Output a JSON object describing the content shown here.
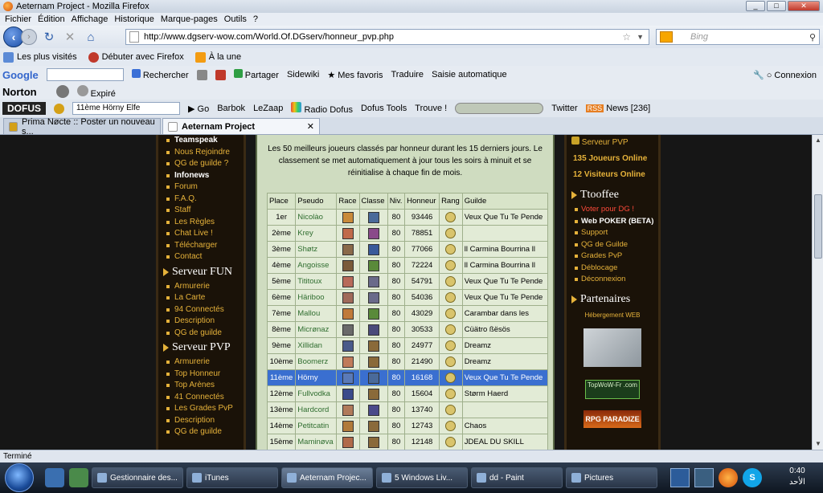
{
  "window": {
    "title": "Aeternam Project - Mozilla Firefox"
  },
  "menu": [
    "Fichier",
    "Édition",
    "Affichage",
    "Historique",
    "Marque-pages",
    "Outils",
    "?"
  ],
  "nav": {
    "url": "http://www.dgserv-wow.com/World.Of.DGserv/honneur_pvp.php",
    "search_placeholder": "Bing"
  },
  "bookmarks": [
    "Les plus visités",
    "Débuter avec Firefox",
    "À la une"
  ],
  "toolbar1": {
    "google": "Google",
    "rechercher": "Rechercher",
    "partager": "Partager",
    "sidewiki": "Sidewiki",
    "favoris": "Mes favoris",
    "traduire": "Traduire",
    "saisie": "Saisie automatique",
    "connexion": "Connexion"
  },
  "toolbar2": {
    "norton": "Norton",
    "expire": "Expiré"
  },
  "toolbar3": {
    "dofus": "DOFUS",
    "search_text": "11ème   Hörny   Elfe",
    "go": "Go",
    "barbok": "Barbok",
    "lezaap": "LeZaap",
    "radio": "Radio Dofus",
    "tools": "Dofus Tools",
    "trouve": "Trouve !",
    "twitter": "Twitter",
    "news": "News [236]"
  },
  "tabs": [
    {
      "label": "Prima Nøcte :: Poster un nouveau s...",
      "active": false
    },
    {
      "label": "Aeternam Project",
      "active": true
    }
  ],
  "left_menu": {
    "top_links": [
      {
        "label": "Teamspeak",
        "white": true
      },
      {
        "label": "Nous Rejoindre",
        "white": false
      },
      {
        "label": "QG de guilde ?",
        "white": false
      },
      {
        "label": "Infonews",
        "white": true
      },
      {
        "label": "Forum",
        "white": false
      },
      {
        "label": "F.A.Q.",
        "white": false
      },
      {
        "label": "Staff",
        "white": false
      },
      {
        "label": "Les Règles",
        "white": false
      },
      {
        "label": "Chat Live !",
        "white": false
      },
      {
        "label": "Télécharger",
        "white": false
      },
      {
        "label": "Contact",
        "white": false
      }
    ],
    "fun_title": "Serveur FUN",
    "fun_links": [
      "Armurerie",
      "La Carte",
      "94 Connectés",
      "Description",
      "QG de guilde"
    ],
    "pvp_title": "Serveur PVP",
    "pvp_links": [
      "Armurerie",
      "Top Honneur",
      "Top Arènes",
      "41 Connectés",
      "Les Grades PvP",
      "Description",
      "QG de guilde"
    ]
  },
  "intro": "Les 50 meilleurs joueurs classés par honneur durant les 15 derniers jours. Le classement se met automatiquement à jour tous les soirs à minuit et se réinitialise à chaque fin de mois.",
  "table": {
    "headers": [
      "Place",
      "Pseudo",
      "Race",
      "Classe",
      "Niv.",
      "Honneur",
      "Rang",
      "Guilde"
    ],
    "rows": [
      {
        "place": "1er",
        "pseudo": "Nicolào",
        "niv": "80",
        "honneur": "93446",
        "guilde": "Veux Que Tu Te Pende"
      },
      {
        "place": "2ème",
        "pseudo": "Krey",
        "niv": "80",
        "honneur": "78851",
        "guilde": ""
      },
      {
        "place": "3ème",
        "pseudo": "Shøtz",
        "niv": "80",
        "honneur": "77066",
        "guilde": "ll Carmina Bourrina ll"
      },
      {
        "place": "4ème",
        "pseudo": "Angoisse",
        "niv": "80",
        "honneur": "72224",
        "guilde": "ll Carmina Bourrina ll"
      },
      {
        "place": "5ème",
        "pseudo": "Tititoux",
        "niv": "80",
        "honneur": "54791",
        "guilde": "Veux Que Tu Te Pende"
      },
      {
        "place": "6ème",
        "pseudo": "Häriboo",
        "niv": "80",
        "honneur": "54036",
        "guilde": "Veux Que Tu Te Pende"
      },
      {
        "place": "7ème",
        "pseudo": "Mallou",
        "niv": "80",
        "honneur": "43029",
        "guilde": "Carambar dans les"
      },
      {
        "place": "8ème",
        "pseudo": "Micrønaz",
        "niv": "80",
        "honneur": "30533",
        "guilde": "Cüätro ßësös"
      },
      {
        "place": "9ème",
        "pseudo": "Xillidan",
        "niv": "80",
        "honneur": "24977",
        "guilde": "Dreamz"
      },
      {
        "place": "10ème",
        "pseudo": "Boomerz",
        "niv": "80",
        "honneur": "21490",
        "guilde": "Dreamz"
      },
      {
        "place": "11ème",
        "pseudo": "Hörny",
        "niv": "80",
        "honneur": "16168",
        "guilde": "Veux Que Tu Te Pende",
        "highlight": true
      },
      {
        "place": "12ème",
        "pseudo": "Fullvodka",
        "niv": "80",
        "honneur": "15604",
        "guilde": "Størm Haerd"
      },
      {
        "place": "13ème",
        "pseudo": "Hardcord",
        "niv": "80",
        "honneur": "13740",
        "guilde": ""
      },
      {
        "place": "14ème",
        "pseudo": "Petitcatin",
        "niv": "80",
        "honneur": "12743",
        "guilde": "Chaos"
      },
      {
        "place": "15ème",
        "pseudo": "Maminøva",
        "niv": "80",
        "honneur": "12148",
        "guilde": "JDEAL DU SKILL"
      }
    ]
  },
  "right_panel": {
    "server": "Serveur PVP",
    "players": "135 Joueurs Online",
    "visitors": "12 Visiteurs Online",
    "user": "Ttooffee",
    "user_links": [
      {
        "label": "Voter pour DG !",
        "style": "red"
      },
      {
        "label": "Web POKER (BETA)",
        "style": "white"
      },
      {
        "label": "Support",
        "style": "normal"
      },
      {
        "label": "QG de Guilde",
        "style": "normal"
      },
      {
        "label": "Grades PvP",
        "style": "normal"
      },
      {
        "label": "Déblocage",
        "style": "normal"
      },
      {
        "label": "Déconnexion",
        "style": "normal"
      }
    ],
    "partners_title": "Partenaires",
    "hosting": "Hébergement WEB",
    "topwow": "TopWoW-Fr .com",
    "rpg": "RPG PARADIZE"
  },
  "status": "Terminé",
  "taskbar": {
    "buttons": [
      {
        "label": "Gestionnaire des...",
        "active": false
      },
      {
        "label": "iTunes",
        "active": false
      },
      {
        "label": "Aeternam Projec...",
        "active": true
      },
      {
        "label": "5 Windows Liv...",
        "active": false
      },
      {
        "label": "dd - Paint",
        "active": false
      },
      {
        "label": "Pictures",
        "active": false
      }
    ],
    "time": "0:40",
    "day": "الأحد"
  },
  "colors": {
    "accent_gold": "#e6b23a",
    "highlight": "#3a6fd0",
    "table_bg": "#cfdcc0"
  }
}
